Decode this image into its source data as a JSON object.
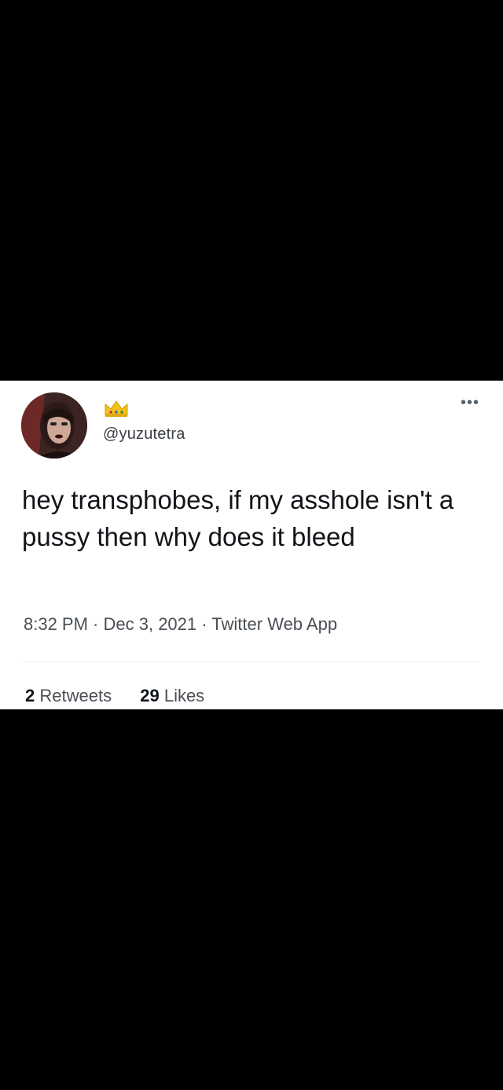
{
  "tweet": {
    "handle": "@yuzutetra",
    "more_label": "•••",
    "text": "hey transphobes, if my asshole isn't a pussy then why does it bleed",
    "time": "8:32 PM",
    "date": "Dec 3, 2021",
    "source": "Twitter Web App",
    "separator": " · ",
    "retweets_count": "2",
    "retweets_label": "Retweets",
    "likes_count": "29",
    "likes_label": "Likes"
  },
  "icons": {
    "avatar": "profile-photo",
    "display_name": "crown-emoji",
    "more": "more-options-icon"
  },
  "colors": {
    "background": "#000000",
    "card": "#ffffff",
    "text": "#0f1419",
    "secondary": "#536471"
  }
}
